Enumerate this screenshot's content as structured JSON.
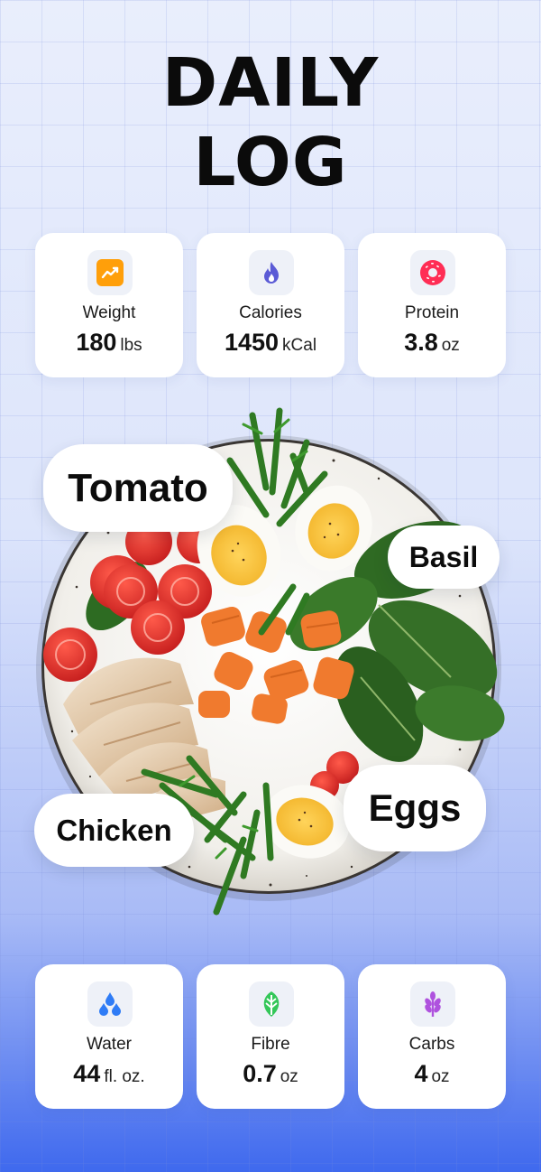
{
  "title": {
    "line1": "DAILY",
    "line2": "LOG"
  },
  "stats_top": [
    {
      "label": "Weight",
      "value": "180",
      "unit": "lbs",
      "icon": "trend-chart-icon",
      "color": "#ff9f0a"
    },
    {
      "label": "Calories",
      "value": "1450",
      "unit": "kCal",
      "icon": "flame-icon",
      "color": "#5b5bd6"
    },
    {
      "label": "Protein",
      "value": "3.8",
      "unit": "oz",
      "icon": "donut-icon",
      "color": "#ff2d55"
    }
  ],
  "stats_bottom": [
    {
      "label": "Water",
      "value": "44",
      "unit": "fl. oz.",
      "icon": "water-drops-icon",
      "color": "#2f7cf6"
    },
    {
      "label": "Fibre",
      "value": "0.7",
      "unit": "oz",
      "icon": "leaf-icon",
      "color": "#34c759"
    },
    {
      "label": "Carbs",
      "value": "4",
      "unit": "oz",
      "icon": "wheat-icon",
      "color": "#af52de"
    }
  ],
  "food_labels": {
    "tomato": "Tomato",
    "basil": "Basil",
    "chicken": "Chicken",
    "eggs": "Eggs"
  }
}
